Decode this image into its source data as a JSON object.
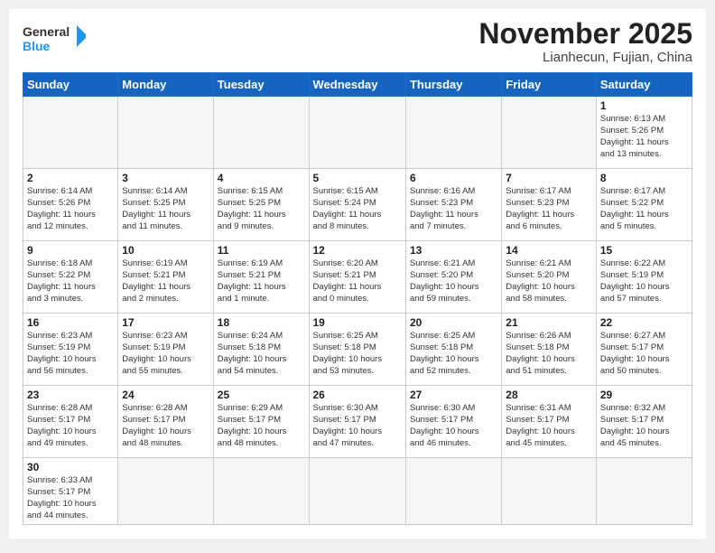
{
  "header": {
    "logo_general": "General",
    "logo_blue": "Blue",
    "month_title": "November 2025",
    "location": "Lianhecun, Fujian, China"
  },
  "days_of_week": [
    "Sunday",
    "Monday",
    "Tuesday",
    "Wednesday",
    "Thursday",
    "Friday",
    "Saturday"
  ],
  "weeks": [
    [
      {
        "day": "",
        "info": ""
      },
      {
        "day": "",
        "info": ""
      },
      {
        "day": "",
        "info": ""
      },
      {
        "day": "",
        "info": ""
      },
      {
        "day": "",
        "info": ""
      },
      {
        "day": "",
        "info": ""
      },
      {
        "day": "1",
        "info": "Sunrise: 6:13 AM\nSunset: 5:26 PM\nDaylight: 11 hours\nand 13 minutes."
      }
    ],
    [
      {
        "day": "2",
        "info": "Sunrise: 6:14 AM\nSunset: 5:26 PM\nDaylight: 11 hours\nand 12 minutes."
      },
      {
        "day": "3",
        "info": "Sunrise: 6:14 AM\nSunset: 5:25 PM\nDaylight: 11 hours\nand 11 minutes."
      },
      {
        "day": "4",
        "info": "Sunrise: 6:15 AM\nSunset: 5:25 PM\nDaylight: 11 hours\nand 9 minutes."
      },
      {
        "day": "5",
        "info": "Sunrise: 6:15 AM\nSunset: 5:24 PM\nDaylight: 11 hours\nand 8 minutes."
      },
      {
        "day": "6",
        "info": "Sunrise: 6:16 AM\nSunset: 5:23 PM\nDaylight: 11 hours\nand 7 minutes."
      },
      {
        "day": "7",
        "info": "Sunrise: 6:17 AM\nSunset: 5:23 PM\nDaylight: 11 hours\nand 6 minutes."
      },
      {
        "day": "8",
        "info": "Sunrise: 6:17 AM\nSunset: 5:22 PM\nDaylight: 11 hours\nand 5 minutes."
      }
    ],
    [
      {
        "day": "9",
        "info": "Sunrise: 6:18 AM\nSunset: 5:22 PM\nDaylight: 11 hours\nand 3 minutes."
      },
      {
        "day": "10",
        "info": "Sunrise: 6:19 AM\nSunset: 5:21 PM\nDaylight: 11 hours\nand 2 minutes."
      },
      {
        "day": "11",
        "info": "Sunrise: 6:19 AM\nSunset: 5:21 PM\nDaylight: 11 hours\nand 1 minute."
      },
      {
        "day": "12",
        "info": "Sunrise: 6:20 AM\nSunset: 5:21 PM\nDaylight: 11 hours\nand 0 minutes."
      },
      {
        "day": "13",
        "info": "Sunrise: 6:21 AM\nSunset: 5:20 PM\nDaylight: 10 hours\nand 59 minutes."
      },
      {
        "day": "14",
        "info": "Sunrise: 6:21 AM\nSunset: 5:20 PM\nDaylight: 10 hours\nand 58 minutes."
      },
      {
        "day": "15",
        "info": "Sunrise: 6:22 AM\nSunset: 5:19 PM\nDaylight: 10 hours\nand 57 minutes."
      }
    ],
    [
      {
        "day": "16",
        "info": "Sunrise: 6:23 AM\nSunset: 5:19 PM\nDaylight: 10 hours\nand 56 minutes."
      },
      {
        "day": "17",
        "info": "Sunrise: 6:23 AM\nSunset: 5:19 PM\nDaylight: 10 hours\nand 55 minutes."
      },
      {
        "day": "18",
        "info": "Sunrise: 6:24 AM\nSunset: 5:18 PM\nDaylight: 10 hours\nand 54 minutes."
      },
      {
        "day": "19",
        "info": "Sunrise: 6:25 AM\nSunset: 5:18 PM\nDaylight: 10 hours\nand 53 minutes."
      },
      {
        "day": "20",
        "info": "Sunrise: 6:25 AM\nSunset: 5:18 PM\nDaylight: 10 hours\nand 52 minutes."
      },
      {
        "day": "21",
        "info": "Sunrise: 6:26 AM\nSunset: 5:18 PM\nDaylight: 10 hours\nand 51 minutes."
      },
      {
        "day": "22",
        "info": "Sunrise: 6:27 AM\nSunset: 5:17 PM\nDaylight: 10 hours\nand 50 minutes."
      }
    ],
    [
      {
        "day": "23",
        "info": "Sunrise: 6:28 AM\nSunset: 5:17 PM\nDaylight: 10 hours\nand 49 minutes."
      },
      {
        "day": "24",
        "info": "Sunrise: 6:28 AM\nSunset: 5:17 PM\nDaylight: 10 hours\nand 48 minutes."
      },
      {
        "day": "25",
        "info": "Sunrise: 6:29 AM\nSunset: 5:17 PM\nDaylight: 10 hours\nand 48 minutes."
      },
      {
        "day": "26",
        "info": "Sunrise: 6:30 AM\nSunset: 5:17 PM\nDaylight: 10 hours\nand 47 minutes."
      },
      {
        "day": "27",
        "info": "Sunrise: 6:30 AM\nSunset: 5:17 PM\nDaylight: 10 hours\nand 46 minutes."
      },
      {
        "day": "28",
        "info": "Sunrise: 6:31 AM\nSunset: 5:17 PM\nDaylight: 10 hours\nand 45 minutes."
      },
      {
        "day": "29",
        "info": "Sunrise: 6:32 AM\nSunset: 5:17 PM\nDaylight: 10 hours\nand 45 minutes."
      }
    ],
    [
      {
        "day": "30",
        "info": "Sunrise: 6:33 AM\nSunset: 5:17 PM\nDaylight: 10 hours\nand 44 minutes."
      },
      {
        "day": "",
        "info": ""
      },
      {
        "day": "",
        "info": ""
      },
      {
        "day": "",
        "info": ""
      },
      {
        "day": "",
        "info": ""
      },
      {
        "day": "",
        "info": ""
      },
      {
        "day": "",
        "info": ""
      }
    ]
  ]
}
